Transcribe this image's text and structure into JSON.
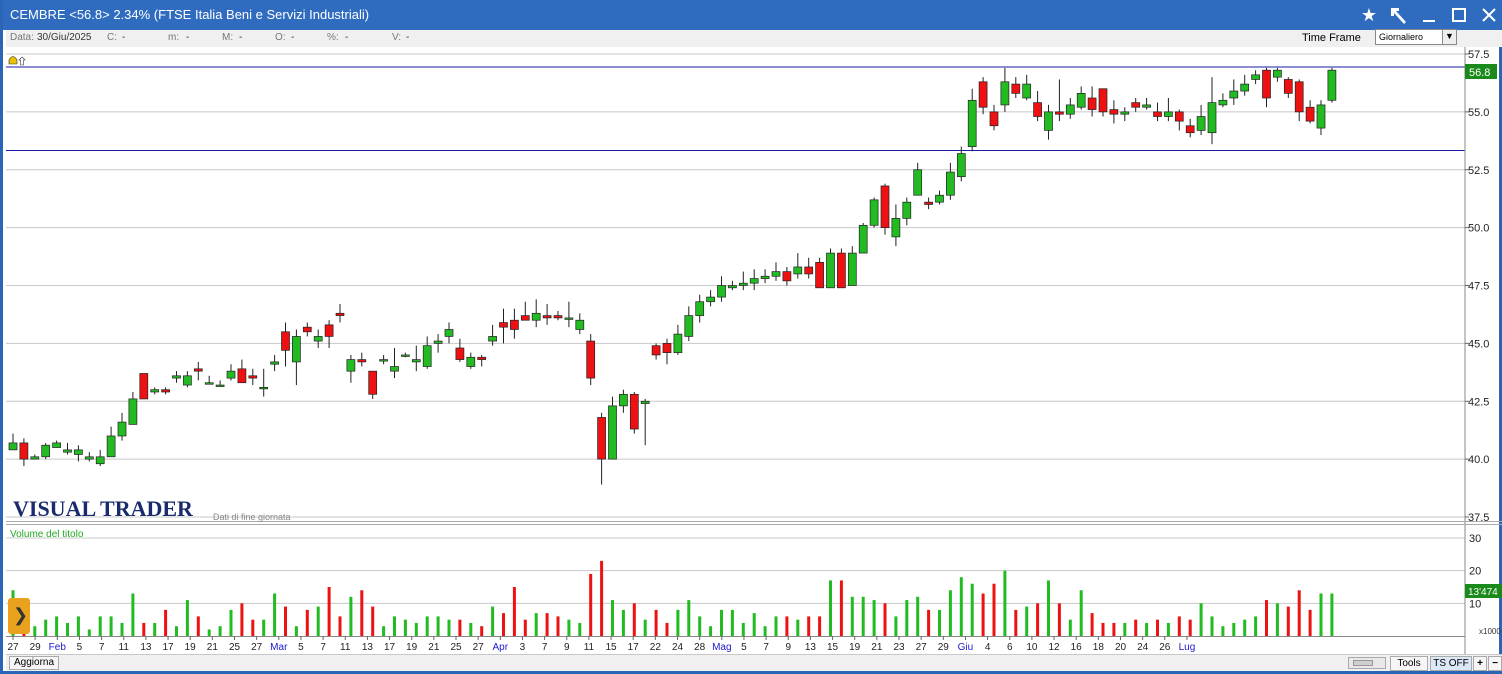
{
  "window": {
    "title": "CEMBRE <56.8> 2.34%  (FTSE Italia Beni e Servizi Industriali)",
    "icons": [
      "star-icon",
      "hammer-icon",
      "minimize-icon",
      "maximize-icon",
      "close-icon"
    ]
  },
  "infobar": {
    "data_label": "Data:",
    "data_value": "30/Giu/2025",
    "c_label": "C:",
    "c_value": "-",
    "m_label": "m:",
    "m_value": "-",
    "M_label": "M:",
    "M_value": "-",
    "o_label": "O:",
    "o_value": "-",
    "pct_label": "%:",
    "pct_value": "-",
    "v_label": "V:",
    "v_value": "-"
  },
  "timeframe": {
    "label": "Time Frame",
    "selected": "Giornaliero"
  },
  "chart": {
    "logo": "VISUAL TRADER",
    "subtitle": "Dati di fine giornata",
    "last_price_label": "56.8",
    "volume_title": "Volume del titolo",
    "volume_last_label": "13'474",
    "volume_unit": "x1000",
    "price_axis": [
      "57.5",
      "55.0",
      "52.5",
      "50.0",
      "47.5",
      "45.0",
      "42.5",
      "40.0",
      "37.5"
    ],
    "volume_axis": [
      "30",
      "20",
      "10"
    ],
    "colors": {
      "up": "#22bb22",
      "down": "#ee1111",
      "hline": "#1a1aa0",
      "grid": "#c8c8c8"
    }
  },
  "chart_data": {
    "type": "candlestick",
    "y_range": [
      37.5,
      57.5
    ],
    "volume_range": [
      0,
      32
    ],
    "horizontal_lines": [
      56.8,
      53.4
    ],
    "x_labels": [
      "27",
      "29",
      "Feb",
      "5",
      "7",
      "11",
      "13",
      "17",
      "19",
      "21",
      "25",
      "27",
      "Mar",
      "5",
      "7",
      "11",
      "13",
      "17",
      "19",
      "21",
      "25",
      "27",
      "Apr",
      "3",
      "7",
      "9",
      "11",
      "15",
      "17",
      "22",
      "24",
      "28",
      "Mag",
      "5",
      "7",
      "9",
      "13",
      "15",
      "19",
      "21",
      "23",
      "27",
      "29",
      "Giu",
      "4",
      "6",
      "10",
      "12",
      "16",
      "18",
      "20",
      "24",
      "26",
      "Lug"
    ],
    "candles": [
      [
        40.4,
        40.7,
        40.4,
        41.1,
        14
      ],
      [
        40.7,
        40.0,
        39.7,
        40.9,
        3
      ],
      [
        40.0,
        40.1,
        40.0,
        40.2,
        3
      ],
      [
        40.1,
        40.6,
        40.0,
        40.7,
        5
      ],
      [
        40.5,
        40.7,
        40.5,
        40.8,
        6
      ],
      [
        40.3,
        40.4,
        40.2,
        40.7,
        4
      ],
      [
        40.2,
        40.4,
        39.9,
        40.6,
        6
      ],
      [
        40.0,
        40.1,
        39.9,
        40.3,
        2
      ],
      [
        39.8,
        40.1,
        39.7,
        40.4,
        6
      ],
      [
        40.1,
        41.0,
        40.1,
        41.4,
        6
      ],
      [
        41.0,
        41.6,
        40.8,
        42.0,
        4
      ],
      [
        41.5,
        42.6,
        41.5,
        42.9,
        13
      ],
      [
        43.7,
        42.6,
        42.6,
        43.7,
        4
      ],
      [
        42.9,
        43.0,
        42.8,
        43.1,
        4
      ],
      [
        43.0,
        42.9,
        42.8,
        43.1,
        8
      ],
      [
        43.5,
        43.6,
        43.3,
        43.8,
        3
      ],
      [
        43.2,
        43.6,
        43.1,
        43.8,
        11
      ],
      [
        43.9,
        43.8,
        43.4,
        44.2,
        6
      ],
      [
        43.3,
        43.3,
        43.3,
        43.6,
        2
      ],
      [
        43.2,
        43.2,
        43.2,
        43.4,
        3
      ],
      [
        43.5,
        43.8,
        43.4,
        44.1,
        8
      ],
      [
        43.9,
        43.3,
        43.3,
        44.3,
        10
      ],
      [
        43.6,
        43.5,
        43.2,
        43.9,
        5
      ],
      [
        43.1,
        43.1,
        42.7,
        43.9,
        5
      ],
      [
        44.1,
        44.2,
        43.8,
        44.5,
        13
      ],
      [
        45.5,
        44.7,
        44.0,
        45.9,
        9
      ],
      [
        44.2,
        45.3,
        43.2,
        45.6,
        3
      ],
      [
        45.7,
        45.5,
        45.3,
        45.9,
        8
      ],
      [
        45.1,
        45.3,
        44.8,
        45.6,
        9
      ],
      [
        45.8,
        45.3,
        44.8,
        46.0,
        15
      ],
      [
        46.3,
        46.2,
        45.9,
        46.7,
        6
      ],
      [
        43.8,
        44.3,
        43.3,
        44.5,
        12
      ],
      [
        44.3,
        44.2,
        44.0,
        44.6,
        14
      ],
      [
        43.8,
        42.8,
        42.6,
        43.8,
        9
      ],
      [
        44.3,
        44.3,
        44.1,
        44.5,
        3
      ],
      [
        43.8,
        44.0,
        43.5,
        44.8,
        6
      ],
      [
        44.5,
        44.5,
        44.4,
        44.6,
        5
      ],
      [
        44.2,
        44.3,
        43.8,
        44.9,
        4
      ],
      [
        44.0,
        44.9,
        43.9,
        45.3,
        6
      ],
      [
        45.0,
        45.1,
        44.6,
        45.4,
        6
      ],
      [
        45.3,
        45.6,
        45.0,
        45.9,
        5
      ],
      [
        44.8,
        44.3,
        44.2,
        45.2,
        5
      ],
      [
        44.0,
        44.4,
        43.9,
        44.6,
        4
      ],
      [
        44.4,
        44.3,
        44.0,
        44.5,
        3
      ],
      [
        45.1,
        45.3,
        44.9,
        45.8,
        9
      ],
      [
        45.9,
        45.7,
        45.0,
        46.5,
        7
      ],
      [
        46.0,
        45.6,
        45.2,
        46.5,
        15
      ],
      [
        46.2,
        46.0,
        46.0,
        46.8,
        5
      ],
      [
        46.0,
        46.3,
        45.7,
        46.9,
        7
      ],
      [
        46.2,
        46.1,
        45.8,
        46.7,
        7
      ],
      [
        46.2,
        46.1,
        46.0,
        46.4,
        6
      ],
      [
        46.1,
        46.1,
        45.7,
        46.8,
        5
      ],
      [
        45.6,
        46.0,
        45.4,
        46.3,
        4
      ],
      [
        45.1,
        43.5,
        43.2,
        45.4,
        19
      ],
      [
        41.8,
        40.0,
        38.9,
        42.0,
        23
      ],
      [
        40.0,
        42.3,
        40.0,
        42.7,
        11
      ],
      [
        42.3,
        42.8,
        42.0,
        43.0,
        8
      ],
      [
        42.8,
        41.3,
        41.1,
        42.9,
        10
      ],
      [
        42.4,
        42.5,
        40.6,
        42.6,
        5
      ],
      [
        44.9,
        44.5,
        44.3,
        45.0,
        8
      ],
      [
        45.0,
        44.6,
        44.1,
        45.2,
        4
      ],
      [
        44.6,
        45.4,
        44.5,
        45.8,
        8
      ],
      [
        45.3,
        46.2,
        45.1,
        46.6,
        11
      ],
      [
        46.2,
        46.8,
        45.9,
        47.1,
        6
      ],
      [
        46.8,
        47.0,
        46.6,
        47.3,
        3
      ],
      [
        47.0,
        47.5,
        46.8,
        47.9,
        8
      ],
      [
        47.4,
        47.5,
        47.3,
        47.7,
        8
      ],
      [
        47.5,
        47.6,
        47.3,
        48.1,
        4
      ],
      [
        47.6,
        47.8,
        47.3,
        48.2,
        7
      ],
      [
        47.8,
        47.9,
        47.6,
        48.2,
        3
      ],
      [
        47.9,
        48.1,
        47.7,
        48.5,
        6
      ],
      [
        48.1,
        47.7,
        47.5,
        48.3,
        6
      ],
      [
        48.0,
        48.3,
        47.8,
        48.9,
        5
      ],
      [
        48.3,
        48.0,
        47.8,
        48.7,
        6
      ],
      [
        48.5,
        47.4,
        47.4,
        48.7,
        6
      ],
      [
        47.4,
        48.9,
        47.4,
        49.1,
        17
      ],
      [
        48.9,
        47.4,
        47.4,
        49.1,
        17
      ],
      [
        47.5,
        48.9,
        47.5,
        49.2,
        12
      ],
      [
        48.9,
        50.1,
        48.9,
        50.2,
        12
      ],
      [
        50.1,
        51.2,
        50.0,
        51.3,
        11
      ],
      [
        51.8,
        50.0,
        49.7,
        51.9,
        10
      ],
      [
        49.6,
        50.4,
        49.2,
        51.0,
        6
      ],
      [
        50.4,
        51.1,
        50.1,
        51.3,
        11
      ],
      [
        51.4,
        52.5,
        51.4,
        52.8,
        12
      ],
      [
        51.1,
        51.0,
        50.8,
        51.3,
        8
      ],
      [
        51.1,
        51.4,
        51.0,
        51.6,
        8
      ],
      [
        51.4,
        52.4,
        51.2,
        52.8,
        14
      ],
      [
        52.2,
        53.2,
        52.0,
        53.5,
        18
      ],
      [
        53.5,
        55.5,
        53.3,
        56.0,
        16
      ],
      [
        56.3,
        55.2,
        54.9,
        56.5,
        13
      ],
      [
        55.0,
        54.4,
        54.2,
        55.3,
        16
      ],
      [
        55.3,
        56.3,
        55.0,
        56.9,
        20
      ],
      [
        56.2,
        55.8,
        55.6,
        56.5,
        8
      ],
      [
        55.6,
        56.2,
        55.5,
        56.6,
        9
      ],
      [
        55.4,
        54.8,
        54.6,
        55.9,
        10
      ],
      [
        54.2,
        55.0,
        53.8,
        55.3,
        17
      ],
      [
        55.0,
        54.9,
        54.6,
        56.4,
        10
      ],
      [
        54.9,
        55.3,
        54.7,
        55.6,
        5
      ],
      [
        55.2,
        55.8,
        55.1,
        56.1,
        14
      ],
      [
        55.6,
        55.1,
        54.8,
        56.1,
        7
      ],
      [
        56.0,
        55.0,
        54.8,
        56.0,
        4
      ],
      [
        55.1,
        54.9,
        54.5,
        55.5,
        4
      ],
      [
        54.9,
        55.0,
        54.6,
        55.2,
        4
      ],
      [
        55.4,
        55.2,
        55.0,
        55.6,
        5
      ],
      [
        55.2,
        55.3,
        55.1,
        55.6,
        4
      ],
      [
        55.0,
        54.8,
        54.6,
        55.4,
        5
      ],
      [
        54.8,
        55.0,
        54.6,
        55.6,
        4
      ],
      [
        55.0,
        54.6,
        54.2,
        55.1,
        6
      ],
      [
        54.4,
        54.1,
        53.9,
        54.7,
        5
      ],
      [
        54.2,
        54.8,
        54.0,
        55.3,
        10
      ],
      [
        54.1,
        55.4,
        53.6,
        56.5,
        6
      ],
      [
        55.3,
        55.5,
        55.2,
        55.8,
        3
      ],
      [
        55.6,
        55.9,
        55.3,
        56.4,
        4
      ],
      [
        55.9,
        56.2,
        55.7,
        56.6,
        5
      ],
      [
        56.4,
        56.6,
        56.2,
        56.8,
        6
      ],
      [
        56.8,
        55.6,
        55.2,
        56.9,
        11
      ],
      [
        56.5,
        56.8,
        56.3,
        56.9,
        10
      ],
      [
        56.4,
        55.8,
        55.6,
        56.5,
        9
      ],
      [
        56.3,
        55.0,
        54.6,
        56.4,
        14
      ],
      [
        55.2,
        54.6,
        54.5,
        55.5,
        8
      ],
      [
        54.3,
        55.3,
        54.0,
        55.5,
        13
      ],
      [
        55.5,
        56.8,
        55.4,
        56.9,
        13
      ]
    ]
  }
}
